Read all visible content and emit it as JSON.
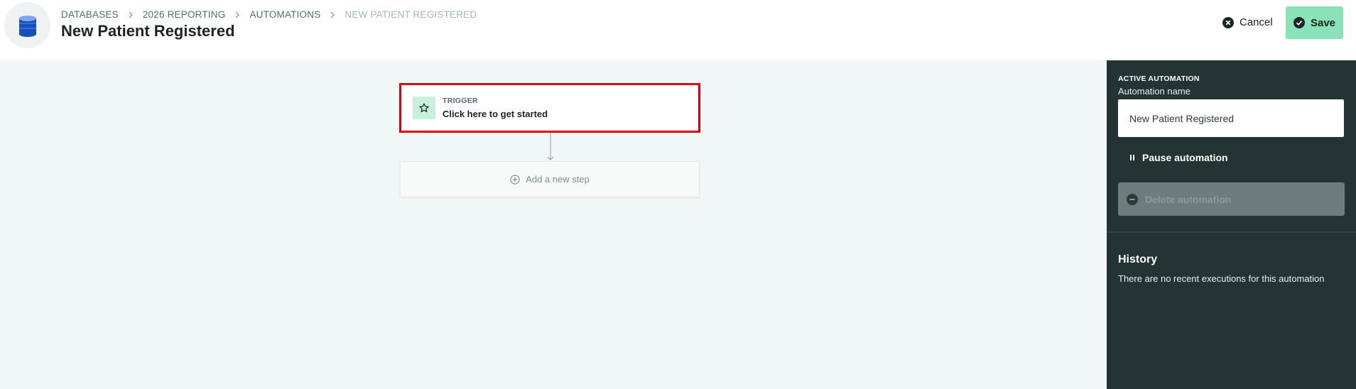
{
  "header": {
    "breadcrumb": [
      "DATABASES",
      "2026 REPORTING",
      "AUTOMATIONS",
      "NEW PATIENT REGISTERED"
    ],
    "title": "New Patient Registered",
    "cancel_label": "Cancel",
    "save_label": "Save",
    "db_icon": "database-icon"
  },
  "canvas": {
    "trigger_label": "TRIGGER",
    "trigger_sub": "Click here to get started",
    "trigger_icon": "star-icon",
    "add_step_label": "Add a new step",
    "add_step_icon": "plus-circle-icon"
  },
  "panel": {
    "active_label": "ACTIVE AUTOMATION",
    "name_label": "Automation name",
    "name_value": "New Patient Registered",
    "pause_label": "Pause automation",
    "delete_label": "Delete automation",
    "history_title": "History",
    "history_empty": "There are no recent executions for this automation"
  },
  "colors": {
    "save_bg": "#8ae2b8",
    "panel_bg": "#243333",
    "highlight": "#e0000d",
    "trigger_icon_bg": "#c8f1dc",
    "canvas_bg": "#f1f6f6"
  }
}
